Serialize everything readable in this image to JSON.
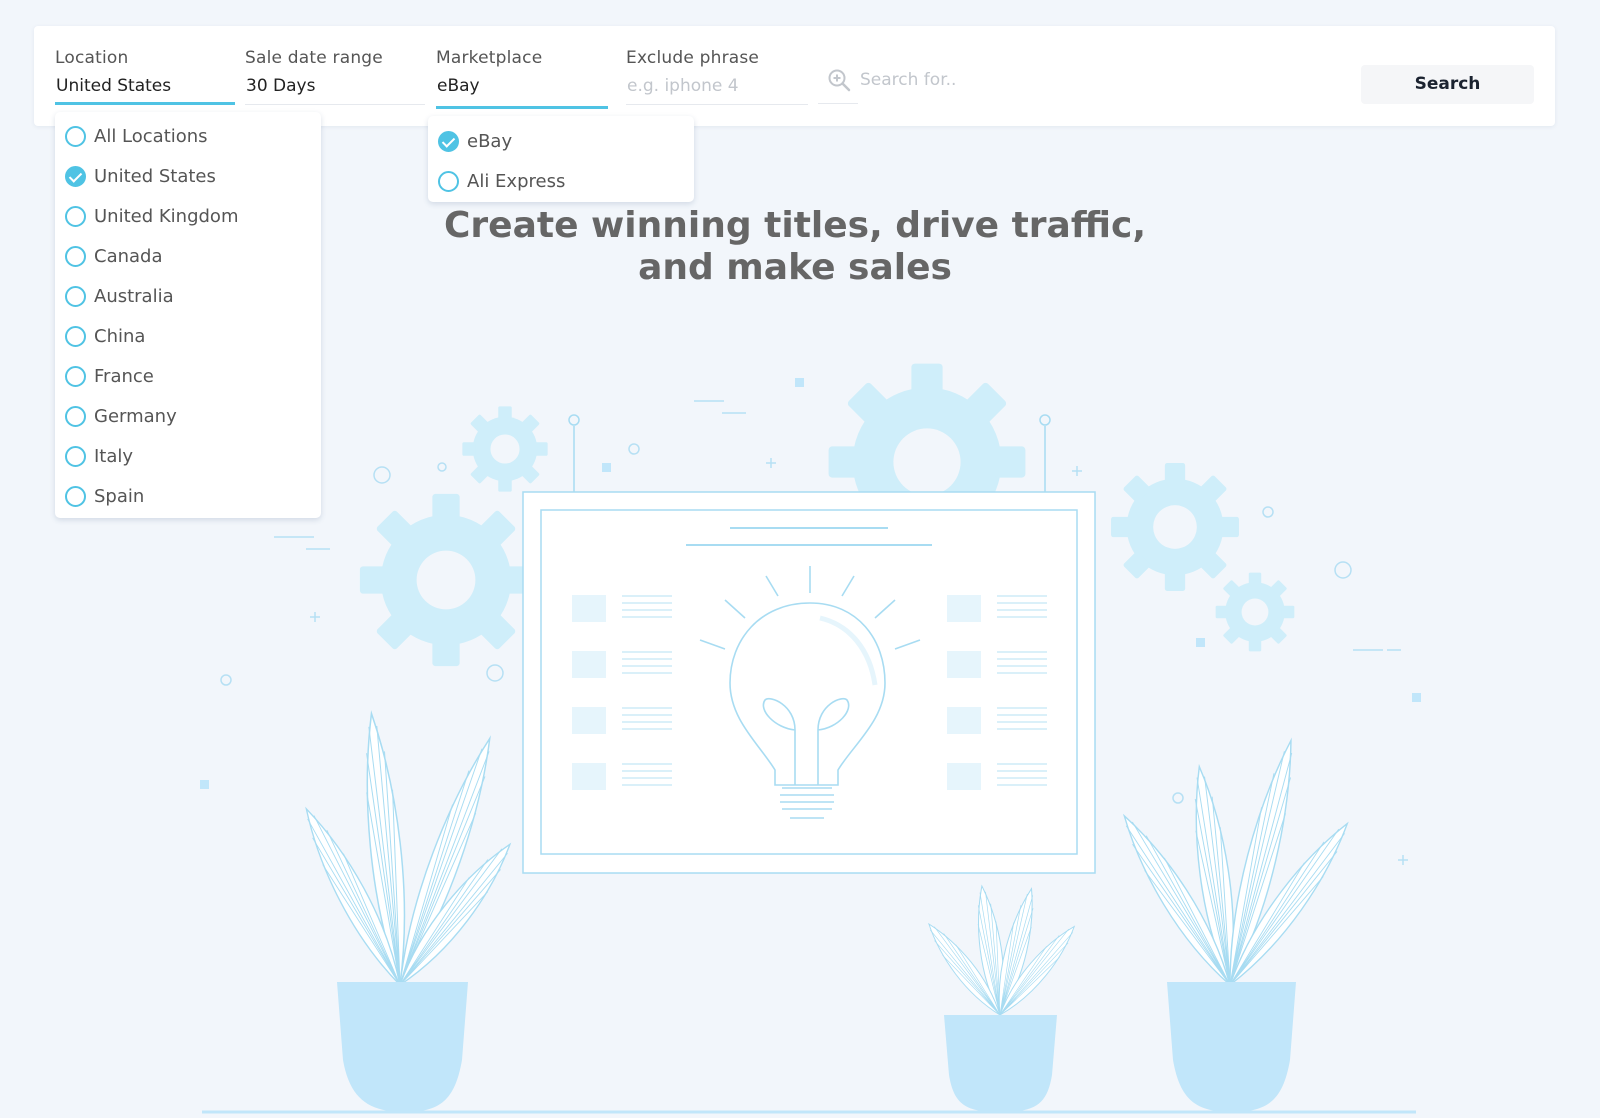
{
  "search_bar": {
    "location": {
      "label": "Location",
      "value": "United States"
    },
    "date_range": {
      "label": "Sale date range",
      "value": "30 Days"
    },
    "marketplace": {
      "label": "Marketplace",
      "value": "eBay"
    },
    "exclude": {
      "label": "Exclude phrase",
      "placeholder": "e.g. iphone 4"
    },
    "search_for": {
      "placeholder": "Search for.."
    },
    "search_button": "Search",
    "search_icon": "zoom-in-icon"
  },
  "location_dropdown": {
    "options": [
      {
        "label": "All Locations",
        "checked": false
      },
      {
        "label": "United States",
        "checked": true
      },
      {
        "label": "United Kingdom",
        "checked": false
      },
      {
        "label": "Canada",
        "checked": false
      },
      {
        "label": "Australia",
        "checked": false
      },
      {
        "label": "China",
        "checked": false
      },
      {
        "label": "France",
        "checked": false
      },
      {
        "label": "Germany",
        "checked": false
      },
      {
        "label": "Italy",
        "checked": false
      },
      {
        "label": "Spain",
        "checked": false
      }
    ]
  },
  "marketplace_dropdown": {
    "options": [
      {
        "label": "eBay",
        "checked": true
      },
      {
        "label": "Ali Express",
        "checked": false
      }
    ]
  },
  "hero": {
    "line1": "Create winning titles, drive traffic,",
    "line2": "and make sales"
  },
  "colors": {
    "accent": "#4fc3e4",
    "background": "#f2f6fb",
    "illustration_fill": "#cfeefa",
    "illustration_stroke": "#a8dcf2"
  }
}
